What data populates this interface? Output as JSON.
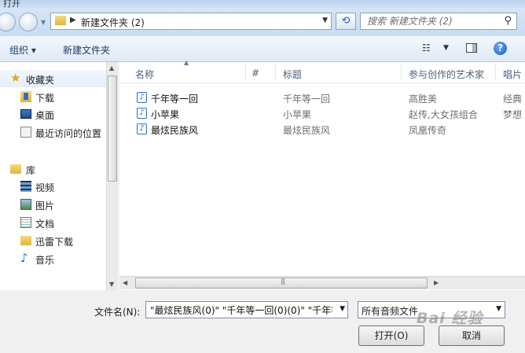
{
  "window": {
    "title": "打开"
  },
  "address": {
    "crumb": "新建文件夹 (2)",
    "search_placeholder": "搜索 新建文件夹 (2)"
  },
  "toolbar": {
    "organize": "组织 ▾",
    "new_folder": "新建文件夹"
  },
  "nav": {
    "favorites": {
      "label": "收藏夹",
      "items": [
        {
          "label": "下载",
          "icon": "download-folder-icon"
        },
        {
          "label": "桌面",
          "icon": "desktop-icon"
        },
        {
          "label": "最近访问的位置",
          "icon": "recent-places-icon"
        }
      ]
    },
    "libraries": {
      "label": "库",
      "items": [
        {
          "label": "视频",
          "icon": "video-library-icon"
        },
        {
          "label": "图片",
          "icon": "pictures-library-icon"
        },
        {
          "label": "文档",
          "icon": "documents-library-icon"
        },
        {
          "label": "迅雷下载",
          "icon": "folder-icon"
        },
        {
          "label": "音乐",
          "icon": "music-library-icon"
        }
      ]
    }
  },
  "files": {
    "columns": [
      "名称",
      "#",
      "标题",
      "参与创作的艺术家",
      "唱片"
    ],
    "rows": [
      {
        "name": "千年等一回",
        "title": "千年等一回",
        "artist": "高胜美",
        "album": "经典"
      },
      {
        "name": "小苹果",
        "title": "小苹果",
        "artist": "赵传,大女孩组合",
        "album": "梦想"
      },
      {
        "name": "最炫民族风",
        "title": "最炫民族风",
        "artist": "凤凰传奇",
        "album": ""
      }
    ]
  },
  "footer": {
    "filename_label": "文件名(N):",
    "filename_value": "\"最炫民族风(0)\" \"千年等一回(0)(0)\" \"千年等",
    "filetype": "所有音频文件",
    "open": "打开(O)",
    "cancel": "取消"
  },
  "watermark": "Bai 经验"
}
